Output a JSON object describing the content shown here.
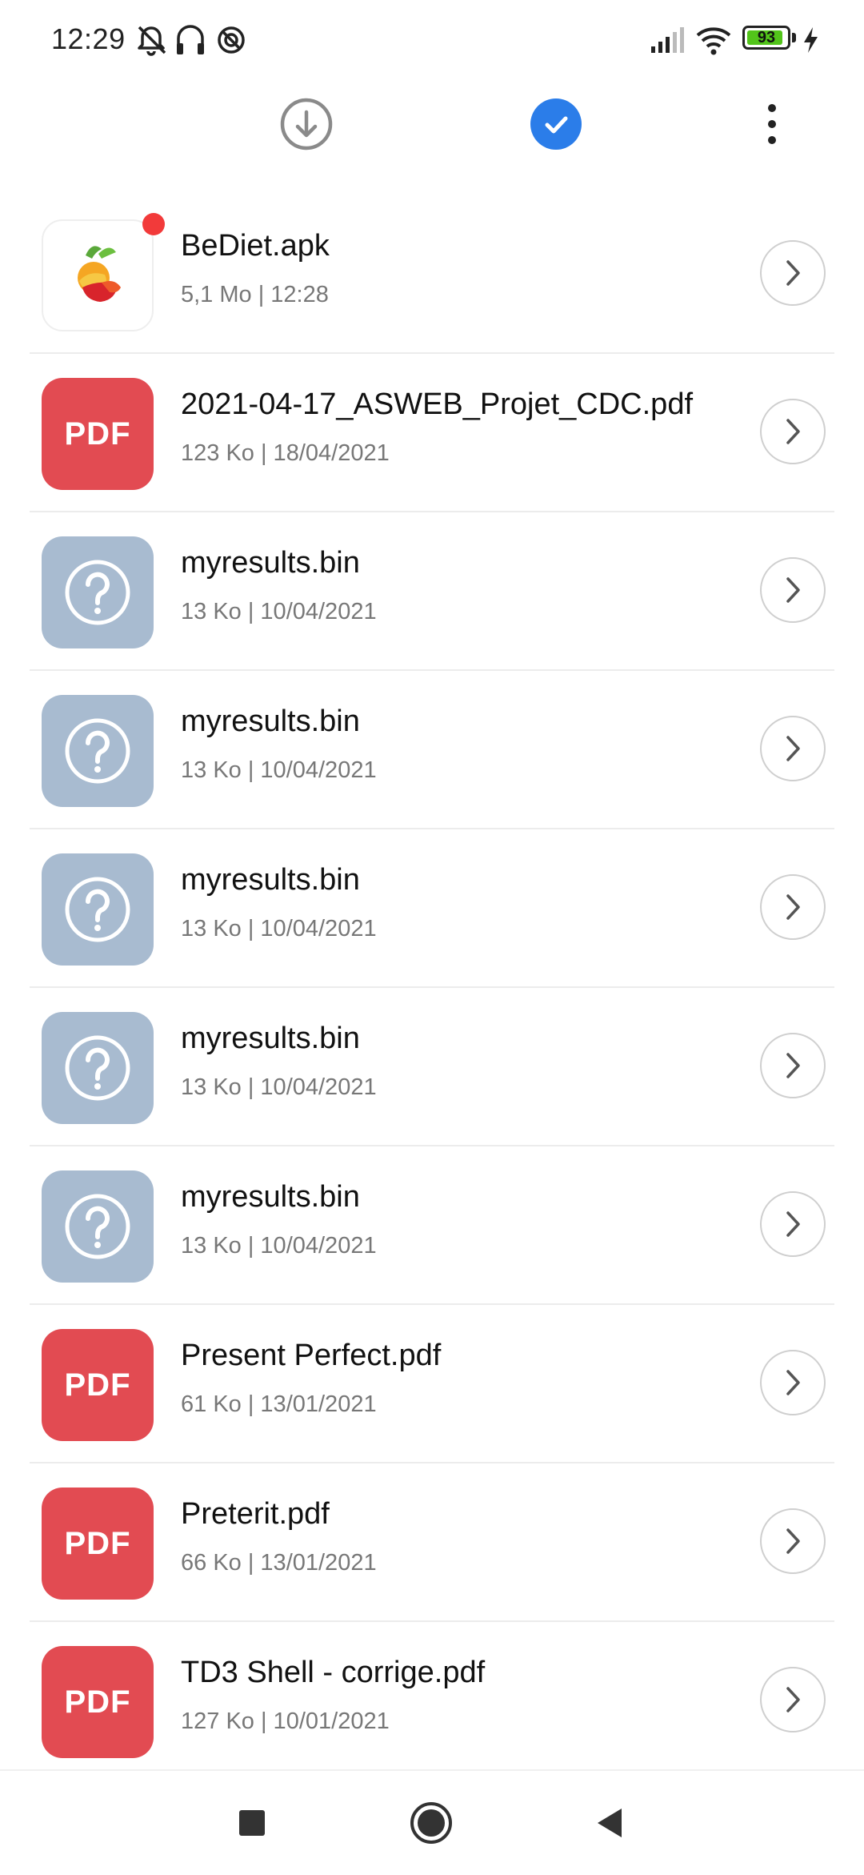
{
  "status_bar": {
    "time": "12:29",
    "icons": [
      "mute-vibrate-icon",
      "headset-icon",
      "data-saver-icon",
      "signal-icon",
      "wifi-icon",
      "battery-icon",
      "charging-icon"
    ],
    "battery_level": "93",
    "battery_color": "#52c41a"
  },
  "toolbar": {
    "download_icon": "download-circle-icon",
    "select_icon": "check-circle-icon",
    "menu_icon": "more-vert-icon",
    "accent_color": "#2b7de9"
  },
  "files": [
    {
      "name": "BeDiet.apk",
      "meta": "5,1 Mo | 12:28",
      "type": "apk",
      "is_new": true
    },
    {
      "name": "2021-04-17_ASWEB_Projet_CDC.pdf",
      "meta": "123 Ko | 18/04/2021",
      "type": "pdf"
    },
    {
      "name": "myresults.bin",
      "meta": "13 Ko | 10/04/2021",
      "type": "unknown"
    },
    {
      "name": "myresults.bin",
      "meta": "13 Ko | 10/04/2021",
      "type": "unknown"
    },
    {
      "name": "myresults.bin",
      "meta": "13 Ko | 10/04/2021",
      "type": "unknown"
    },
    {
      "name": "myresults.bin",
      "meta": "13 Ko | 10/04/2021",
      "type": "unknown"
    },
    {
      "name": "myresults.bin",
      "meta": "13 Ko | 10/04/2021",
      "type": "unknown"
    },
    {
      "name": "Present Perfect.pdf",
      "meta": "61 Ko | 13/01/2021",
      "type": "pdf"
    },
    {
      "name": "Preterit.pdf",
      "meta": "66 Ko | 13/01/2021",
      "type": "pdf"
    },
    {
      "name": "TD3 Shell - corrige.pdf",
      "meta": "127 Ko | 10/01/2021",
      "type": "pdf"
    }
  ],
  "pdf_badge_label": "PDF",
  "nav_bar": {
    "recents_icon": "recents-square-icon",
    "home_icon": "home-circle-icon",
    "back_icon": "back-triangle-icon"
  }
}
